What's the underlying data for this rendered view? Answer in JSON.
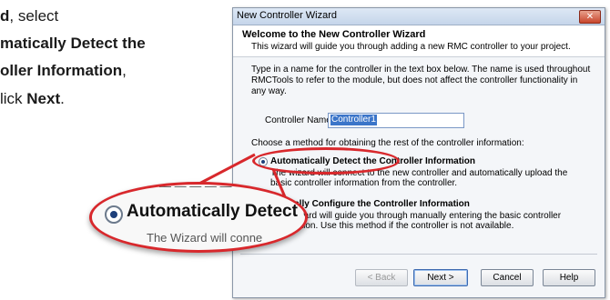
{
  "instructions": {
    "line1_bold": "d",
    "line1_rest": ", select",
    "line2": "matically Detect the",
    "line3_bold": "oller Information",
    "line3_rest": ",",
    "line4_pre": "lick ",
    "line4_bold": "Next",
    "line4_post": "."
  },
  "window": {
    "title": "New Controller Wizard",
    "close_label": "✕",
    "header_title": "Welcome to the New Controller Wizard",
    "header_sub": "This wizard will guide you through adding a new RMC controller to your project."
  },
  "form": {
    "description": "Type in a name for the controller in the text box below. The name is used throughout RMCTools to refer to the module, but does not affect the controller functionality in any way.",
    "name_label": "Controller Name:",
    "name_value": "Controller1",
    "method_question": "Choose a method for obtaining the rest of the controller information:",
    "options": [
      {
        "label": "Automatically Detect the Controller Information",
        "desc": "The wizard will connect to the new controller and automatically upload the basic controller information from the controller.",
        "selected": true
      },
      {
        "label": "Manually Configure the Controller Information",
        "desc": "The Wizard will guide you through manually entering the basic controller information. Use this method if the controller is not available.",
        "selected": false
      }
    ]
  },
  "buttons": {
    "back": "< Back",
    "next": "Next >",
    "cancel": "Cancel",
    "help": "Help"
  },
  "callout": {
    "zoom_text": "Automatically Detect the C",
    "above_text": "— — — — —",
    "below_text": "The Wizard will conne"
  },
  "colors": {
    "highlight": "#d8282c",
    "accent": "#3b75c9"
  }
}
